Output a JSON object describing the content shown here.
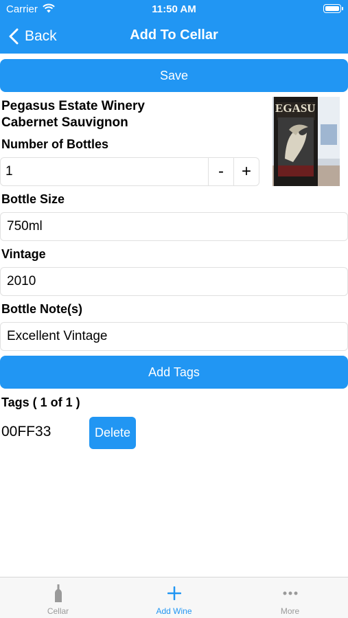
{
  "status_bar": {
    "carrier": "Carrier",
    "time": "11:50 AM"
  },
  "nav": {
    "back_label": "Back",
    "title": "Add To Cellar"
  },
  "save_label": "Save",
  "wine": {
    "winery": "Pegasus Estate Winery",
    "varietal": "Cabernet Sauvignon"
  },
  "form": {
    "bottles_label": "Number of Bottles",
    "bottles_value": "1",
    "decrement": "-",
    "increment": "+",
    "size_label": "Bottle Size",
    "size_value": "750ml",
    "vintage_label": "Vintage",
    "vintage_value": "2010",
    "notes_label": "Bottle Note(s)",
    "notes_value": "Excellent Vintage"
  },
  "photo_label": "EGASU",
  "add_tags_label": "Add Tags",
  "tags": {
    "header": "Tags ( 1  of  1 )",
    "items": [
      {
        "value": "00FF33",
        "delete_label": "Delete"
      }
    ]
  },
  "tabs": [
    {
      "label": "Cellar",
      "icon": "bottle-icon"
    },
    {
      "label": "Add Wine",
      "icon": "plus-icon",
      "active": true
    },
    {
      "label": "More",
      "icon": "more-icon"
    }
  ],
  "colors": {
    "accent": "#2196f3",
    "inactive": "#9a9a9a"
  }
}
